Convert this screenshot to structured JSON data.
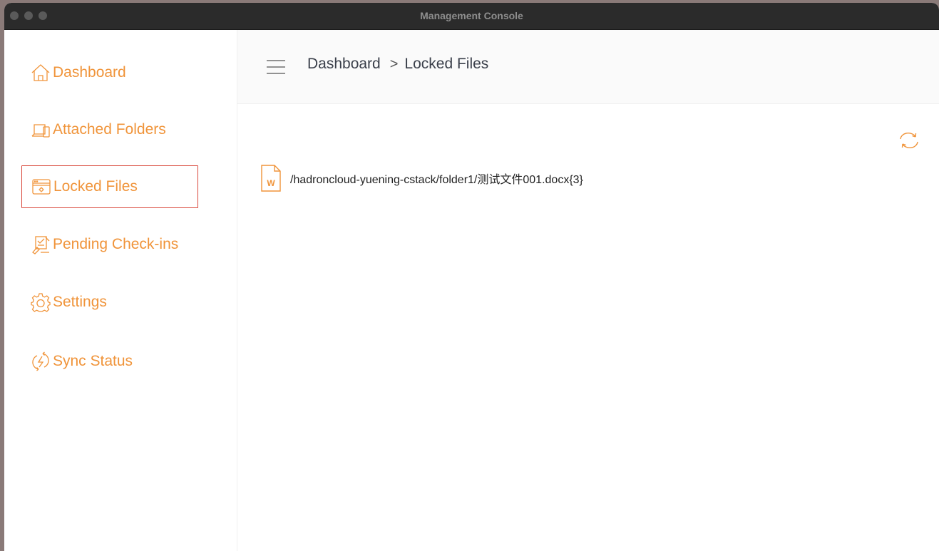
{
  "window": {
    "title": "Management Console"
  },
  "sidebar": {
    "items": [
      {
        "label": "Dashboard",
        "icon": "home-icon"
      },
      {
        "label": "Attached Folders",
        "icon": "folders-icon"
      },
      {
        "label": "Locked Files",
        "icon": "locked-window-icon",
        "active": true
      },
      {
        "label": "Pending Check-ins",
        "icon": "checkin-icon"
      },
      {
        "label": "Settings",
        "icon": "gear-icon"
      },
      {
        "label": "Sync Status",
        "icon": "sync-icon"
      }
    ]
  },
  "header": {
    "menu_icon": "hamburger-icon",
    "breadcrumb": {
      "root": "Dashboard",
      "separator": ">",
      "current": "Locked Files"
    }
  },
  "toolbar": {
    "refresh_icon": "refresh-icon"
  },
  "locked_files": [
    {
      "icon": "word-file-icon",
      "icon_letter": "W",
      "path": "/hadroncloud-yuening-cstack/folder1/测试文件001.docx{3}"
    }
  ],
  "colors": {
    "accent": "#f0943a",
    "active_border": "#d9473a",
    "titlebar": "#2b2b2b",
    "text": "#3a3f4a"
  }
}
